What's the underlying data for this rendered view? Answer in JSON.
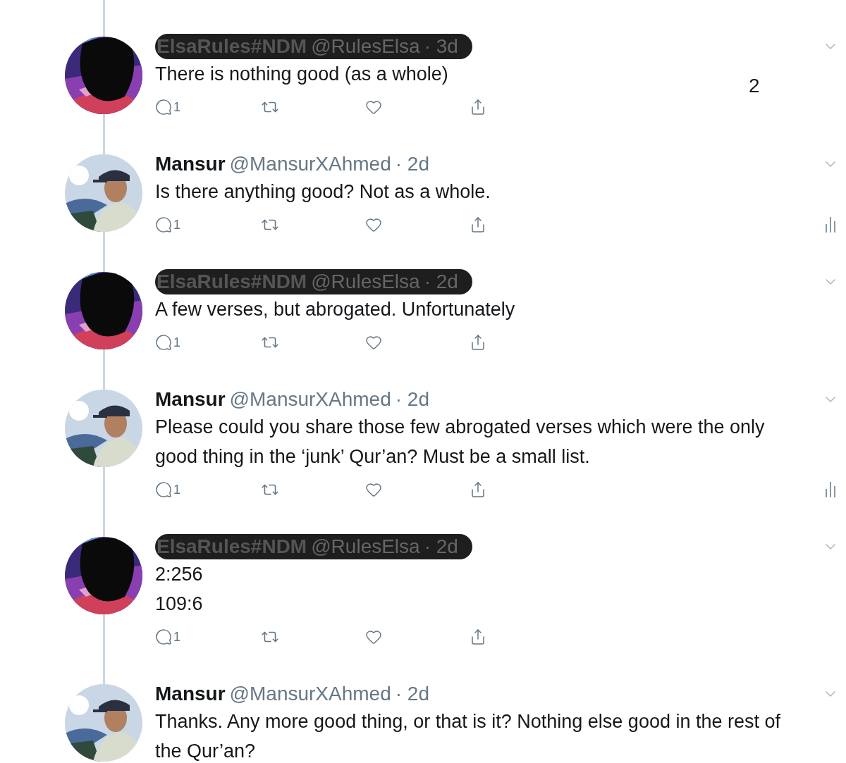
{
  "page_number": "2",
  "tweets": [
    {
      "name": "ElsaRules#NDM",
      "handle": "@RulesElsa",
      "time": "· 3d",
      "redacted": true,
      "avatar": {
        "kind": "picture"
      },
      "text": [
        "There is nothing good (as a whole)"
      ],
      "reply_count": "1",
      "analytics": false
    },
    {
      "name": "Mansur",
      "handle": "@MansurXAhmed",
      "time": "· 2d",
      "redacted": false,
      "avatar": {
        "kind": "picture"
      },
      "text": [
        "Is there anything good? Not as a whole."
      ],
      "reply_count": "1",
      "analytics": true
    },
    {
      "name": "ElsaRules#NDM",
      "handle": "@RulesElsa",
      "time": "· 2d",
      "redacted": true,
      "avatar": {
        "kind": "picture"
      },
      "text": [
        "A few verses, but abrogated. Unfortunately"
      ],
      "reply_count": "1",
      "analytics": false
    },
    {
      "name": "Mansur",
      "handle": "@MansurXAhmed",
      "time": "· 2d",
      "redacted": false,
      "avatar": {
        "kind": "picture"
      },
      "text": [
        "Please could you share those few abrogated verses which were the only",
        "good thing in the ‘junk’ Qur’an? Must be a small list."
      ],
      "reply_count": "1",
      "analytics": true
    },
    {
      "name": "ElsaRules#NDM",
      "handle": "@RulesElsa",
      "time": "· 2d",
      "redacted": true,
      "avatar": {
        "kind": "picture"
      },
      "text": [
        "2:256",
        "109:6"
      ],
      "reply_count": "1",
      "analytics": false
    },
    {
      "name": "Mansur",
      "handle": "@MansurXAhmed",
      "time": "· 2d",
      "redacted": false,
      "avatar": {
        "kind": "picture"
      },
      "text": [
        "Thanks. Any more good thing, or that is it? Nothing else good in the rest of",
        "the Qur’an?"
      ],
      "analytics": false
    }
  ]
}
